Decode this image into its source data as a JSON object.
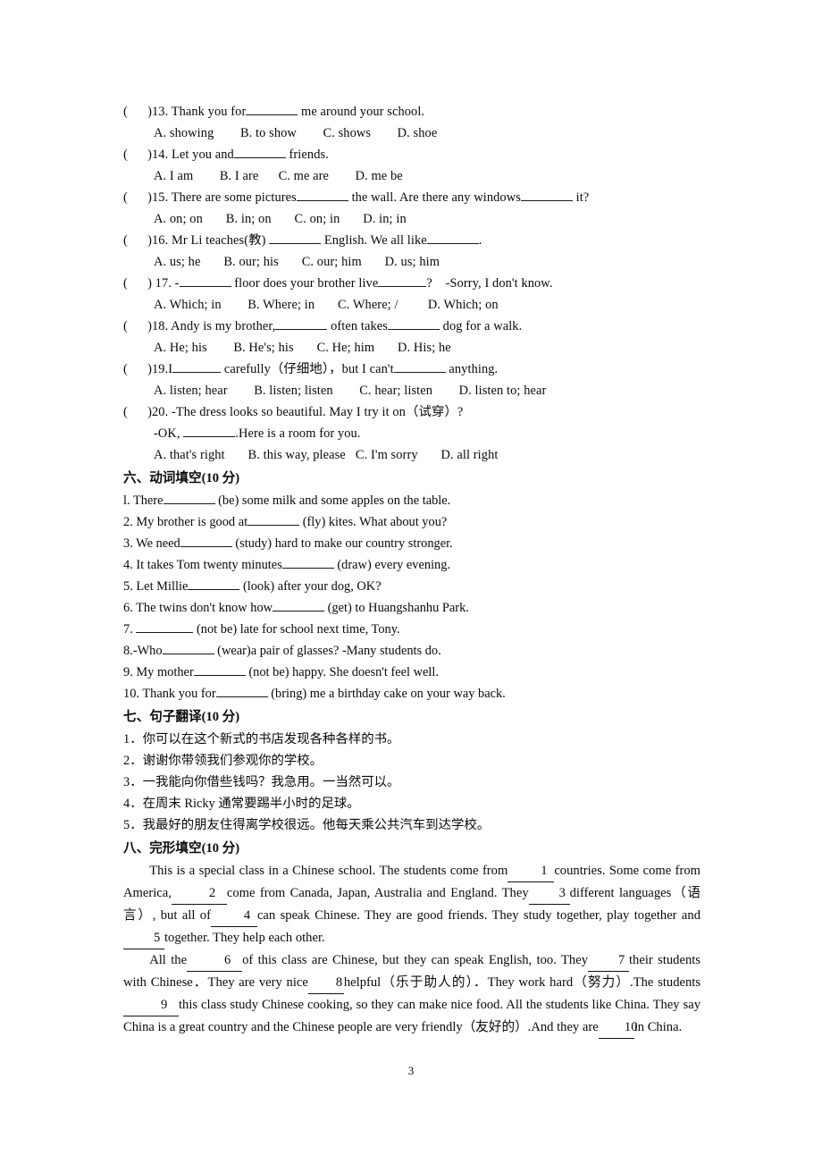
{
  "page": {
    "number": "3"
  },
  "multiple_choice": {
    "questions": [
      {
        "bracket": "(      )",
        "number": "13.",
        "stem_before": " Thank you for",
        "stem_after": " me around your school.",
        "options": "A. showing        B. to show        C. shows        D. shoe"
      },
      {
        "bracket": "(      )",
        "number": "14.",
        "stem_before": " Let you and",
        "stem_after": " friends.",
        "options": "A. I am        B. I are      C. me are        D. me be"
      },
      {
        "bracket": "(      )",
        "number": "15.",
        "stem_before": " There are some pictures",
        "stem_mid": " the wall. Are there any windows",
        "stem_after": " it?",
        "options": "A. on; on       B. in; on       C. on; in       D. in; in"
      },
      {
        "bracket": "(      )",
        "number": "16.",
        "stem_before": " Mr Li teaches(教) ",
        "stem_mid": " English. We all like",
        "stem_after": ".",
        "options": "A. us; he       B. our; his       C. our; him       D. us; him"
      },
      {
        "bracket": "(      )",
        "number": " 17.",
        "stem_before": " -",
        "stem_mid": " floor does your brother live",
        "stem_after": "?    -Sorry, I don't know.",
        "options": "A. Which; in        B. Where; in       C. Where; /         D. Which; on"
      },
      {
        "bracket": "(      )",
        "number": "18.",
        "stem_before": " Andy is my brother,",
        "stem_mid": " often takes",
        "stem_after": " dog for a walk.",
        "options": "A. He; his        B. He's; his       C. He; him       D. His; he"
      },
      {
        "bracket": "(      )",
        "number": "19.",
        "stem_before": "I",
        "stem_mid": " carefully（仔细地），but I can't",
        "stem_after": " anything.",
        "options": "A. listen; hear        B. listen; listen        C. hear; listen        D. listen to; hear"
      },
      {
        "bracket": "(      )",
        "number": "20.",
        "stem_before": " -The dress looks so beautiful. May I try it on（试穿）?",
        "stem_second": "-OK, ",
        "stem_second_after": ".Here is a room for you.",
        "options": "A. that's right       B. this way, please   C. I'm sorry       D. all right"
      }
    ]
  },
  "section_six": {
    "heading_cn": "六、动词填空",
    "heading_score": "(10 分)",
    "items": [
      {
        "num": "l. ",
        "before": "There",
        "after": " (be) some milk and some apples on the table."
      },
      {
        "num": "2. ",
        "before": "My brother is good at",
        "after": " (fly) kites. What about you?"
      },
      {
        "num": "3. ",
        "before": "We need",
        "after": " (study) hard to make our country stronger."
      },
      {
        "num": "4. ",
        "before": "It takes Tom twenty minutes",
        "after": " (draw) every evening."
      },
      {
        "num": "5. ",
        "before": "Let Millie",
        "after": " (look) after your dog, OK?"
      },
      {
        "num": "6. ",
        "before": "The twins don't know how",
        "after": " (get) to Huangshanhu Park."
      },
      {
        "num": "7. ",
        "before": "",
        "after": " (not be) late for school next time, Tony."
      },
      {
        "num": "8.",
        "before": "-Who",
        "after": " (wear)a pair of glasses? -Many students do."
      },
      {
        "num": "9. ",
        "before": "My mother",
        "after": " (not be) happy. She doesn't feel well."
      },
      {
        "num": "10. ",
        "before": "Thank you for",
        "after": " (bring) me a birthday cake on your way back."
      }
    ]
  },
  "section_seven": {
    "heading_cn": "七、句子翻译",
    "heading_score": "(10 分)",
    "items": [
      "1．你可以在这个新式的书店发现各种各样的书。",
      "2．谢谢你带领我们参观你的学校。",
      "3．一我能向你借些钱吗？我急用。一当然可以。",
      "4．在周末 Ricky 通常要踢半小时的足球。",
      "5．我最好的朋友住得离学校很远。他每天乘公共汽车到达学校。"
    ]
  },
  "section_eight": {
    "heading_cn": "八、完形填空",
    "heading_score": "(10 分)",
    "paragraph1": {
      "t1": "This is a special class in a Chinese school. The students come from",
      "b1": "1",
      "t2": "countries. Some come from America,",
      "b2": "2",
      "t3": "come from Canada, Japan, Australia and England. They",
      "b3": "3",
      "t4": "different languages（语言）, but all of",
      "b4": "4",
      "t5": "can speak Chinese. They are good friends. They study together, play together and",
      "b5": "5",
      "t6": "together. They help each other."
    },
    "paragraph2": {
      "t1": "All the",
      "b6": "6",
      "t2": "of this class are Chinese, but they can speak English, too. They",
      "b7": "7",
      "t3": "their students with Chinese．They are very nice",
      "b8": "8",
      "t4": "helpful（乐于助人的）．They work hard（努力）.The students",
      "b9": "9",
      "t5": "this class study Chinese cooking, so they can make nice food. All the students like China. They say China is a great country and the Chinese people are very friendly（友好的）.And they are",
      "b10": "10",
      "t6": "in China."
    }
  }
}
